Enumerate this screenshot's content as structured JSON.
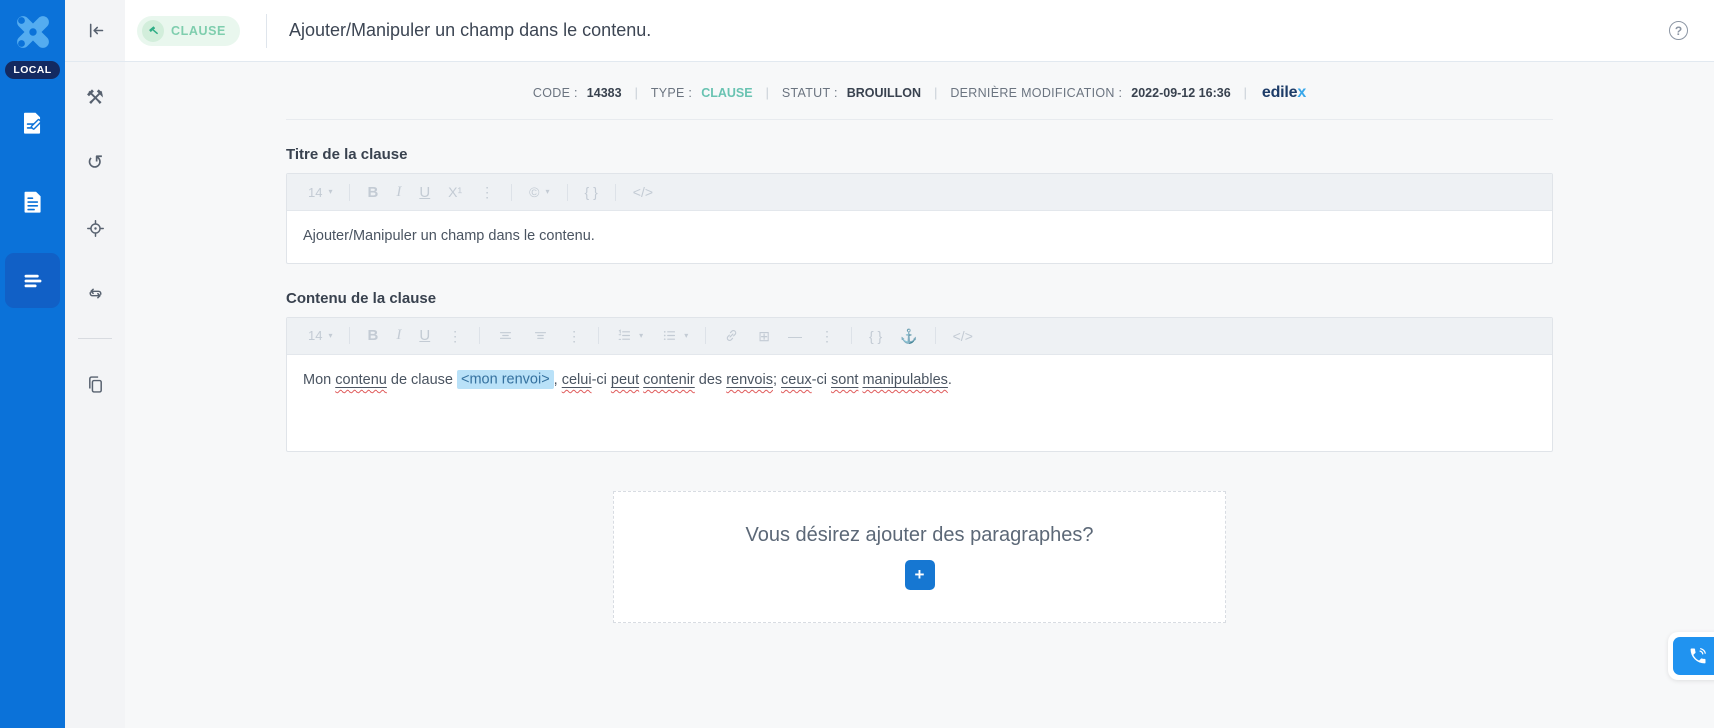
{
  "app": {
    "env_badge": "LOCAL"
  },
  "colors": {
    "sidebar_blue": "#0b72d9",
    "active_item_blue": "#1160c6",
    "accent_blue": "#1677d2",
    "type_badge_bg": "#e9f7ee",
    "type_badge_text": "#7fceae",
    "meta_type_teal": "#69c3b2",
    "field_highlight_bg": "#b9e1f8",
    "field_highlight_text": "#35719f",
    "brand_navy": "#1d3c68",
    "brand_x_blue": "#38a7ea",
    "phone_blue": "#2093f0"
  },
  "header": {
    "badge_label": "CLAUSE",
    "title": "Ajouter/Manipuler un champ dans le contenu.",
    "help_glyph": "?"
  },
  "sidebar": {
    "items": [
      {
        "name": "sidebar-item-redaction",
        "icon": "doc-edit",
        "active": false
      },
      {
        "name": "sidebar-item-documents",
        "icon": "doc",
        "active": false
      },
      {
        "name": "sidebar-item-clauses",
        "icon": "list-menu",
        "active": true
      }
    ]
  },
  "tools_sidebar": {
    "collapse": {
      "name": "collapse-sidebar-button",
      "icon": "collapse-left"
    },
    "items": [
      {
        "name": "tools-button",
        "glyph": "⚒"
      },
      {
        "name": "history-button",
        "glyph": "↺"
      },
      {
        "name": "locate-button",
        "icon": "locate"
      },
      {
        "name": "repeat-button",
        "icon": "repeat"
      },
      {
        "name": "divider",
        "divider": true
      },
      {
        "name": "copy-button",
        "icon": "copy"
      }
    ]
  },
  "meta": {
    "items": [
      {
        "label": "CODE :",
        "value": "14383",
        "teal": false
      },
      {
        "label": "TYPE :",
        "value": "CLAUSE",
        "teal": true
      },
      {
        "label": "STATUT :",
        "value": "BROUILLON",
        "teal": false
      },
      {
        "label": "DERNIÈRE MODIFICATION :",
        "value": "2022-09-12 16:36",
        "teal": false
      }
    ],
    "brand_main": "edile",
    "brand_x": "x"
  },
  "title_editor": {
    "label": "Titre de la clause",
    "toolbar": [
      {
        "name": "font-size-select",
        "glyph": "14",
        "caret": true
      },
      {
        "sep": true
      },
      {
        "name": "bold-button",
        "glyph": "B"
      },
      {
        "name": "italic-button",
        "glyph": "I"
      },
      {
        "name": "underline-button",
        "glyph": "U"
      },
      {
        "name": "superscript-button",
        "glyph": "X¹"
      },
      {
        "name": "overflow-menu-button",
        "glyph": "⋮"
      },
      {
        "sep": true
      },
      {
        "name": "special-characters-button",
        "glyph": "©",
        "caret": true
      },
      {
        "sep": true
      },
      {
        "name": "braces-button",
        "glyph": "{ }"
      },
      {
        "sep": true
      },
      {
        "name": "source-code-button",
        "glyph": "</>"
      }
    ],
    "content": "Ajouter/Manipuler un champ dans le contenu."
  },
  "content_editor": {
    "label": "Contenu de la clause",
    "toolbar": [
      {
        "name": "font-size-select",
        "glyph": "14",
        "caret": true
      },
      {
        "sep": true
      },
      {
        "name": "bold-button",
        "glyph": "B"
      },
      {
        "name": "italic-button",
        "glyph": "I"
      },
      {
        "name": "underline-button",
        "glyph": "U"
      },
      {
        "name": "overflow-menu-button",
        "glyph": "⋮"
      },
      {
        "sep": true
      },
      {
        "name": "align-left-button",
        "icon": "align-1"
      },
      {
        "name": "align-center-button",
        "icon": "align-2"
      },
      {
        "name": "align-overflow-button",
        "glyph": "⋮"
      },
      {
        "sep": true
      },
      {
        "name": "ordered-list-button",
        "icon": "list-ol",
        "caret": true
      },
      {
        "name": "bullet-list-button",
        "icon": "list-ul",
        "caret": true
      },
      {
        "sep": true
      },
      {
        "name": "link-button",
        "icon": "link"
      },
      {
        "name": "insert-table-button",
        "glyph": "⊞"
      },
      {
        "name": "horizontal-rule-button",
        "glyph": "—"
      },
      {
        "name": "insert-overflow-button",
        "glyph": "⋮"
      },
      {
        "sep": true
      },
      {
        "name": "braces-button",
        "glyph": "{ }"
      },
      {
        "name": "anchor-button",
        "glyph": "⚓"
      },
      {
        "sep": true
      },
      {
        "name": "source-code-button",
        "glyph": "</>"
      }
    ],
    "segments": [
      {
        "type": "plain",
        "text": "Mon "
      },
      {
        "type": "misspelled",
        "text": "contenu"
      },
      {
        "type": "plain",
        "text": " de clause "
      },
      {
        "type": "field",
        "text": "<mon renvoi>"
      },
      {
        "type": "plain",
        "text": ", "
      },
      {
        "type": "misspelled",
        "text": "celui"
      },
      {
        "type": "plain",
        "text": "-ci "
      },
      {
        "type": "misspelled",
        "text": "peut"
      },
      {
        "type": "plain",
        "text": " "
      },
      {
        "type": "misspelled",
        "text": "contenir"
      },
      {
        "type": "plain",
        "text": " des "
      },
      {
        "type": "misspelled",
        "text": "renvois"
      },
      {
        "type": "plain",
        "text": "; "
      },
      {
        "type": "misspelled",
        "text": "ceux"
      },
      {
        "type": "plain",
        "text": "-ci "
      },
      {
        "type": "misspelled",
        "text": "sont"
      },
      {
        "type": "plain",
        "text": " "
      },
      {
        "type": "misspelled",
        "text": "manipulables"
      },
      {
        "type": "plain",
        "text": "."
      }
    ]
  },
  "paragraph_box": {
    "question": "Vous désirez ajouter des paragraphes?",
    "add_button": "+"
  }
}
